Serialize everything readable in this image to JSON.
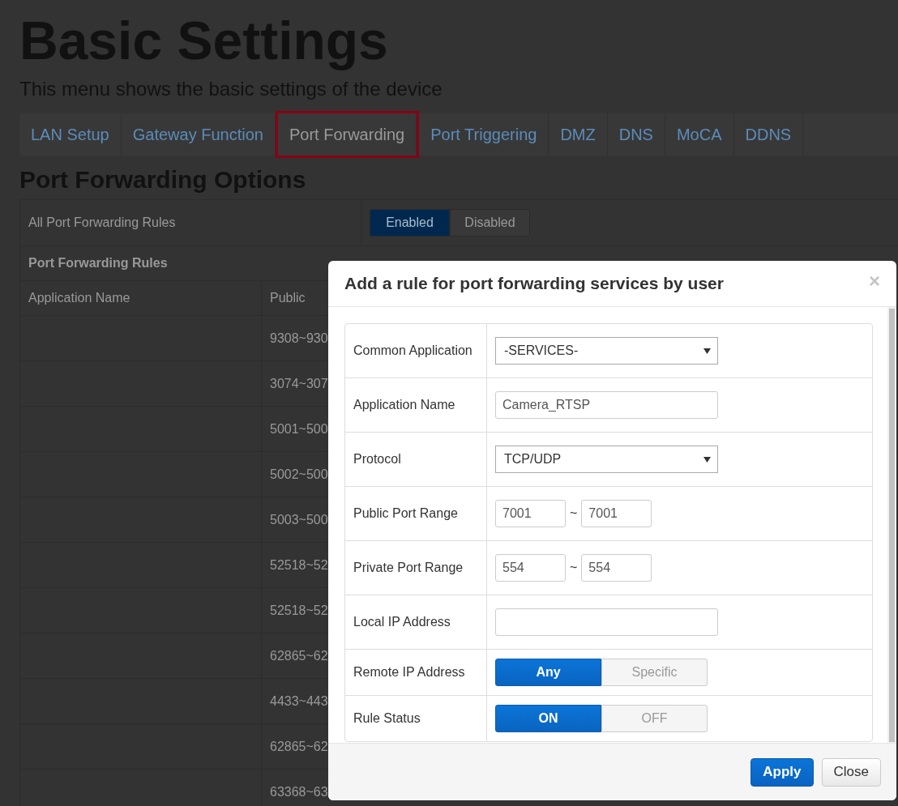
{
  "page": {
    "title": "Basic Settings",
    "subtitle": "This menu shows the basic settings of the device"
  },
  "tabs": [
    {
      "label": "LAN Setup",
      "selected": false
    },
    {
      "label": "Gateway Function",
      "selected": false
    },
    {
      "label": "Port Forwarding",
      "selected": true
    },
    {
      "label": "Port Triggering",
      "selected": false
    },
    {
      "label": "DMZ",
      "selected": false
    },
    {
      "label": "DNS",
      "selected": false
    },
    {
      "label": "MoCA",
      "selected": false
    },
    {
      "label": "DDNS",
      "selected": false
    }
  ],
  "section_title": "Port Forwarding Options",
  "all_rules": {
    "label": "All Port Forwarding Rules",
    "options": [
      {
        "label": "Enabled",
        "selected": true
      },
      {
        "label": "Disabled",
        "selected": false
      }
    ]
  },
  "rules_table": {
    "title": "Port Forwarding Rules",
    "columns": [
      "Application Name",
      "Public"
    ],
    "rows": [
      {
        "public": "9308~930"
      },
      {
        "public": "3074~307"
      },
      {
        "public": "5001~500"
      },
      {
        "public": "5002~500"
      },
      {
        "public": "5003~500"
      },
      {
        "public": "52518~52"
      },
      {
        "public": "52518~52"
      },
      {
        "public": "62865~62"
      },
      {
        "public": "4433~443"
      },
      {
        "public": "62865~62"
      },
      {
        "public": "63368~63"
      }
    ]
  },
  "dialog": {
    "title": "Add a rule for port forwarding services by user",
    "close": "×",
    "fields": [
      {
        "kind": "select",
        "label": "Common Application",
        "value": "-SERVICES-"
      },
      {
        "kind": "text",
        "label": "Application Name",
        "value": "Camera_RTSP"
      },
      {
        "kind": "select",
        "label": "Protocol",
        "value": "TCP/UDP"
      },
      {
        "kind": "range",
        "label": "Public Port Range",
        "from": "7001",
        "separator": "~",
        "to": "7001"
      },
      {
        "kind": "range",
        "label": "Private Port Range",
        "from": "554",
        "separator": "~",
        "to": "554"
      },
      {
        "kind": "text",
        "label": "Local IP Address"
      },
      {
        "kind": "toggle",
        "label": "Remote IP Address",
        "options": [
          {
            "label": "Any",
            "selected": true
          },
          {
            "label": "Specific",
            "selected": false
          }
        ]
      },
      {
        "kind": "toggle",
        "label": "Rule Status",
        "options": [
          {
            "label": "ON",
            "selected": true
          },
          {
            "label": "OFF",
            "selected": false
          }
        ]
      }
    ],
    "buttons": [
      {
        "label": "Apply",
        "kind": "primary"
      },
      {
        "label": "Close",
        "kind": "default"
      }
    ]
  }
}
